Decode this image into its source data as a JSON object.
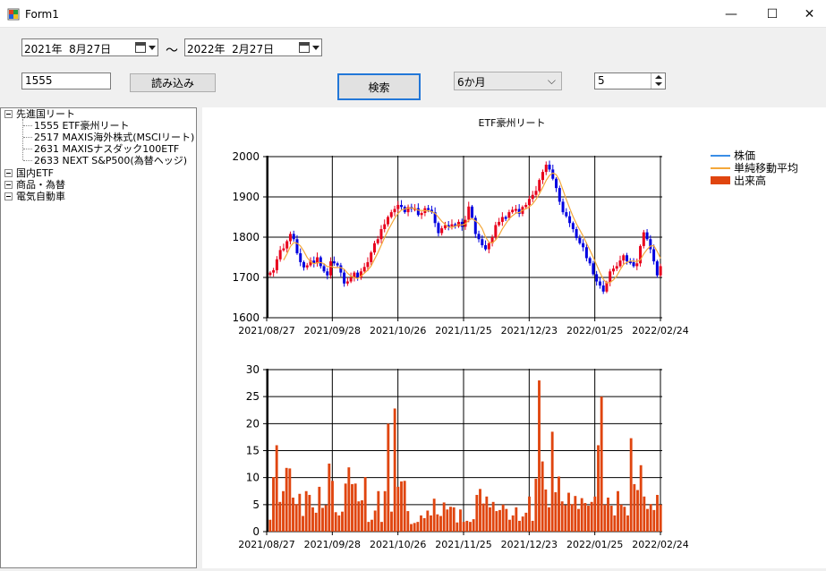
{
  "window": {
    "title": "Form1",
    "minimize": "—",
    "maximize": "☐",
    "close": "✕"
  },
  "controls": {
    "date_from": "2021年  8月27日",
    "date_to": "2022年  2月27日",
    "tilde": "～",
    "code_input": "1555",
    "load_button": "読み込み",
    "search_button": "検索",
    "period_select": "6か月",
    "ma_period": "5"
  },
  "tree": {
    "root": "先進国リート",
    "children": [
      "1555 ETF豪州リート",
      "2517 MAXIS海外株式(MSCIリート)",
      "2631 MAXISナスダック100ETF",
      "2633 NEXT S&P500(為替ヘッジ)"
    ],
    "others": [
      "国内ETF",
      "商品・為替",
      "電気自動車"
    ]
  },
  "icons": {
    "calendar": "calendar-icon",
    "dropdown": "chevron-down-icon",
    "app": "app-icon"
  },
  "colors": {
    "up": "#e8001c",
    "down": "#0000e0",
    "price_line": "#3a8ee6",
    "ma_line": "#f4a83a",
    "volume": "#e0450f"
  },
  "chart_data": [
    {
      "type": "candlestick",
      "title": "ETF豪州リート",
      "ylim": [
        1600,
        2000
      ],
      "yticks": [
        1600,
        1700,
        1800,
        1900,
        2000
      ],
      "x_labels": [
        "2021/08/27",
        "2021/09/28",
        "2021/10/26",
        "2021/11/25",
        "2021/12/23",
        "2022/01/25",
        "2022/02/24"
      ],
      "legend": [
        "株価",
        "単純移動平均",
        "出来高"
      ],
      "legend_position": "top-right",
      "grid": true,
      "close": [
        1712,
        1718,
        1745,
        1768,
        1772,
        1790,
        1808,
        1795,
        1760,
        1738,
        1725,
        1730,
        1742,
        1735,
        1750,
        1728,
        1715,
        1705,
        1740,
        1735,
        1730,
        1712,
        1685,
        1690,
        1700,
        1712,
        1700,
        1715,
        1726,
        1738,
        1762,
        1785,
        1795,
        1820,
        1832,
        1850,
        1862,
        1870,
        1880,
        1875,
        1862,
        1875,
        1870,
        1872,
        1855,
        1860,
        1872,
        1868,
        1862,
        1835,
        1810,
        1822,
        1830,
        1827,
        1832,
        1827,
        1838,
        1826,
        1843,
        1876,
        1848,
        1808,
        1795,
        1780,
        1770,
        1785,
        1800,
        1830,
        1838,
        1850,
        1848,
        1862,
        1868,
        1870,
        1858,
        1875,
        1880,
        1895,
        1905,
        1915,
        1942,
        1962,
        1980,
        1968,
        1945,
        1922,
        1888,
        1862,
        1852,
        1835,
        1820,
        1798,
        1785,
        1775,
        1748,
        1735,
        1708,
        1690,
        1680,
        1665,
        1688,
        1715,
        1722,
        1728,
        1742,
        1755,
        1740,
        1738,
        1728,
        1735,
        1778,
        1812,
        1795,
        1770,
        1740,
        1705,
        1728
      ]
    },
    {
      "type": "bar",
      "ylim": [
        0,
        30
      ],
      "yticks": [
        0,
        5,
        10,
        15,
        20,
        25,
        30
      ],
      "x_labels": [
        "2021/08/27",
        "2021/09/28",
        "2021/10/26",
        "2021/11/25",
        "2021/12/23",
        "2022/01/25",
        "2022/02/24"
      ],
      "grid": true,
      "volume": [
        2.2,
        10.1,
        16.0,
        5.5,
        7.5,
        11.8,
        11.7,
        6.3,
        5.1,
        7.0,
        2.9,
        7.5,
        6.8,
        4.5,
        3.5,
        8.3,
        4.4,
        4.9,
        12.6,
        9.4,
        3.6,
        3.0,
        3.7,
        8.9,
        11.9,
        8.8,
        8.9,
        5.6,
        5.8,
        10.1,
        1.8,
        2.2,
        3.9,
        7.5,
        1.8,
        7.5,
        20.0,
        3.7,
        22.8,
        8.3,
        9.3,
        9.4,
        3.8,
        1.4,
        1.6,
        1.8,
        3.0,
        2.5,
        3.9,
        3.0,
        6.1,
        3.2,
        2.9,
        5.4,
        4.1,
        4.6,
        4.5,
        1.7,
        4.1,
        1.8,
        2.0,
        1.8,
        2.3,
        6.8,
        7.9,
        5.2,
        6.5,
        4.5,
        5.5,
        3.8,
        4.0,
        5.0,
        4.2,
        2.2,
        3.0,
        4.5,
        2.0,
        2.8,
        3.5,
        6.5,
        2.0,
        9.8,
        28.0,
        13.0,
        7.8,
        4.5,
        18.5,
        7.3,
        10.2,
        5.6,
        4.9,
        7.2,
        5.1,
        6.6,
        4.2,
        6.2,
        5.3,
        4.8,
        5.5,
        6.5,
        16.0,
        25.0,
        5.0,
        6.3,
        4.8,
        3.0,
        7.5,
        5.0,
        4.6,
        3.0,
        17.3,
        8.8,
        7.7,
        12.3,
        6.5,
        4.2,
        5.1,
        4.0,
        6.8,
        5.0
      ]
    }
  ]
}
